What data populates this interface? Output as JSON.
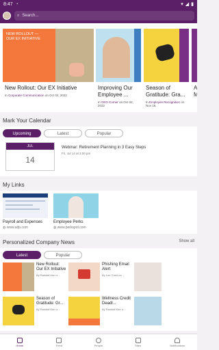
{
  "status": {
    "time": "8:47"
  },
  "search": {
    "placeholder": "Search..."
  },
  "carousel": [
    {
      "title": "New Rollout: Our EX Initiative",
      "prefix": "In",
      "channel": "Corporate Communication",
      "date": "on Oct 04, 2022",
      "overlay": "NEW ROLLOUT — OUR EX INITIATIVE"
    },
    {
      "title": "Improving Our Employee ...",
      "prefix": "In",
      "channel": "CEO Corner",
      "date": "on Oct 04, 2022"
    },
    {
      "title": "Season of Gratitude: Gra...",
      "prefix": "In",
      "channel": "Employee Recognition",
      "date": "on Nov 16,"
    },
    {
      "title": "A M"
    }
  ],
  "calendar": {
    "heading": "Mark Your Calendar",
    "tabs": [
      "Upcoming",
      "Latest",
      "Popular"
    ],
    "event": {
      "month": "JUL",
      "day": "14",
      "title": "Webinar: Retirement Planning in 3 Easy Steps",
      "time": "Fri, Jul 14 at 3:00 pm"
    }
  },
  "links": {
    "heading": "My Links",
    "items": [
      {
        "name": "Payroll and Expenses",
        "url": "www.adp.com"
      },
      {
        "name": "Employee Perks",
        "url": "www.perkspot.com"
      }
    ]
  },
  "news": {
    "heading": "Personalized Company News",
    "show_all": "Show all",
    "tabs": [
      "Latest",
      "Popular"
    ],
    "items": [
      {
        "title": "New Rollout: Our EX Initiative",
        "author": "By Randall Kerr o..."
      },
      {
        "title": "Phishing Email Alert",
        "author": "By Lori Chen on ..."
      },
      {
        "title": "",
        "author": ""
      },
      {
        "title": "Season of Gratitude: Gr...",
        "author": "By Randall Kerr o..."
      },
      {
        "title": "Wellness Credit Deadl...",
        "author": "By Randall Kerr o..."
      },
      {
        "title": "",
        "author": ""
      }
    ]
  },
  "nav": [
    "Home",
    "Feed",
    "People",
    "Sites",
    "Notifications"
  ],
  "colors": {
    "brand": "#5a1f66",
    "accent_orange": "#f4773b"
  }
}
